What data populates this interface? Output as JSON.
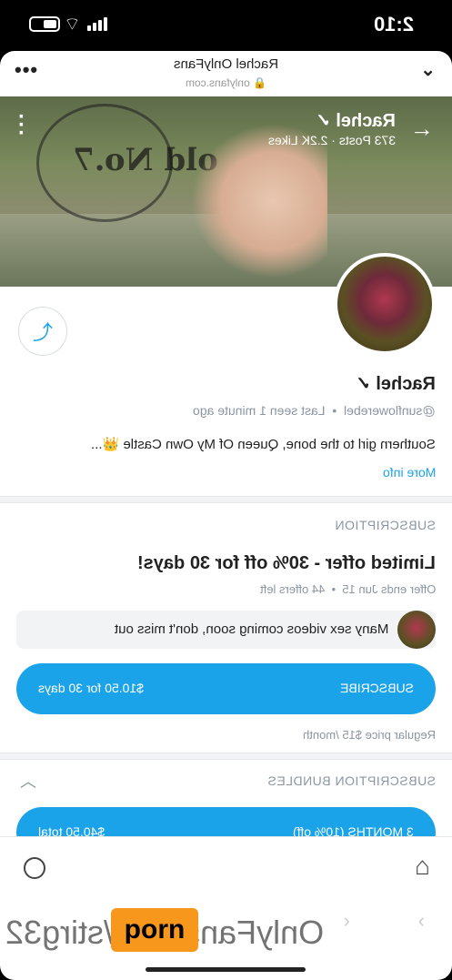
{
  "status_bar": {
    "time": "2:10"
  },
  "browser": {
    "title": "Rachel OnlyFans",
    "url": "onlyfans.com"
  },
  "banner": {
    "name": "Rachel",
    "stats": "373 Posts · 2.2K Likes",
    "logo_text": "old No.7"
  },
  "profile": {
    "name": "Rachel",
    "handle": "@sunflowerebel",
    "last_seen": "Last seen 1 minute ago",
    "bio": "Southern girl to the bone, Queen Of My Own Castle 👑...",
    "more_info": "More info"
  },
  "subscription": {
    "heading": "SUBSCRIPTION",
    "offer_title": "Limited offer - 30% off for 30 days!",
    "offer_ends": "Offer ends Jun 15",
    "offers_left": "44 offers left",
    "message": "Many sex videos coming soon, don't miss out",
    "subscribe_label": "SUBSCRIBE",
    "subscribe_price": "$10.50 for 30 days",
    "regular_price": "Regular price $15 /month"
  },
  "bundles": {
    "heading": "SUBSCRIPTION BUNDLES",
    "items": [
      {
        "label": "3 MONTHS (10% off)",
        "price": "$40.50 total"
      }
    ]
  },
  "watermark": {
    "text": "OnlyFans.com/stirg32",
    "badge": "porn"
  },
  "colors": {
    "accent": "#1aa3e8",
    "muted": "#8a96a3",
    "badge": "#f7981d"
  }
}
